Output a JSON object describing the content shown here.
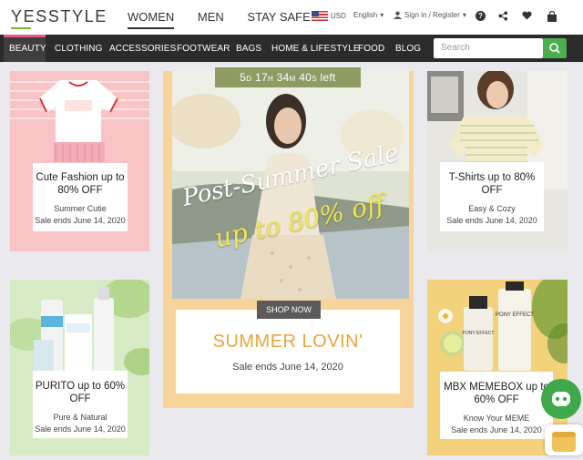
{
  "header": {
    "logo": "YESSTYLE",
    "nav": [
      "WOMEN",
      "MEN",
      "STAY SAFE"
    ],
    "currency": "USD",
    "language": "English",
    "account": "Sign in / Register",
    "icons": [
      "help-icon",
      "share-icon",
      "wishlist-icon",
      "cart-icon"
    ]
  },
  "categories": [
    "BEAUTY",
    "CLOTHING",
    "ACCESSORIES",
    "FOOTWEAR",
    "BAGS",
    "HOME & LIFESTYLE",
    "FOOD",
    "BLOG"
  ],
  "search": {
    "placeholder": "Search"
  },
  "cards": {
    "left_top": {
      "title": "Cute Fashion up to 80% OFF",
      "sub1": "Summer Cutie",
      "sub2": "Sale ends June 14, 2020"
    },
    "left_bottom": {
      "title": "PURITO up to 60% OFF",
      "sub1": "Pure & Natural",
      "sub2": "Sale ends June 14, 2020"
    },
    "right_top": {
      "title": "T-Shirts up to 80% OFF",
      "sub1": "Easy & Cozy",
      "sub2": "Sale ends June 14, 2020"
    },
    "right_bottom": {
      "title": "MBX MEMEBOX up to 60% OFF",
      "sub1": "Know Your MEME",
      "sub2": "Sale ends June 14, 2020"
    }
  },
  "hero": {
    "timer": {
      "d": "5",
      "d_unit": "D",
      "h": "17",
      "h_unit": "H",
      "m": "34",
      "m_unit": "M",
      "s": "40",
      "s_unit": "S",
      "suffix": "left"
    },
    "script_text_1": "Post-Summer Sale",
    "script_text_2": "up to 80% off",
    "cta": "SHOP NOW",
    "title": "SUMMER LOVIN'",
    "sub": "Sale ends June 14, 2020"
  },
  "colors": {
    "brand_green": "#4bae4f",
    "beauty_pink": "#e75a8d",
    "hero_title": "#e7a73c",
    "timer_bg": "#8e9c63"
  }
}
